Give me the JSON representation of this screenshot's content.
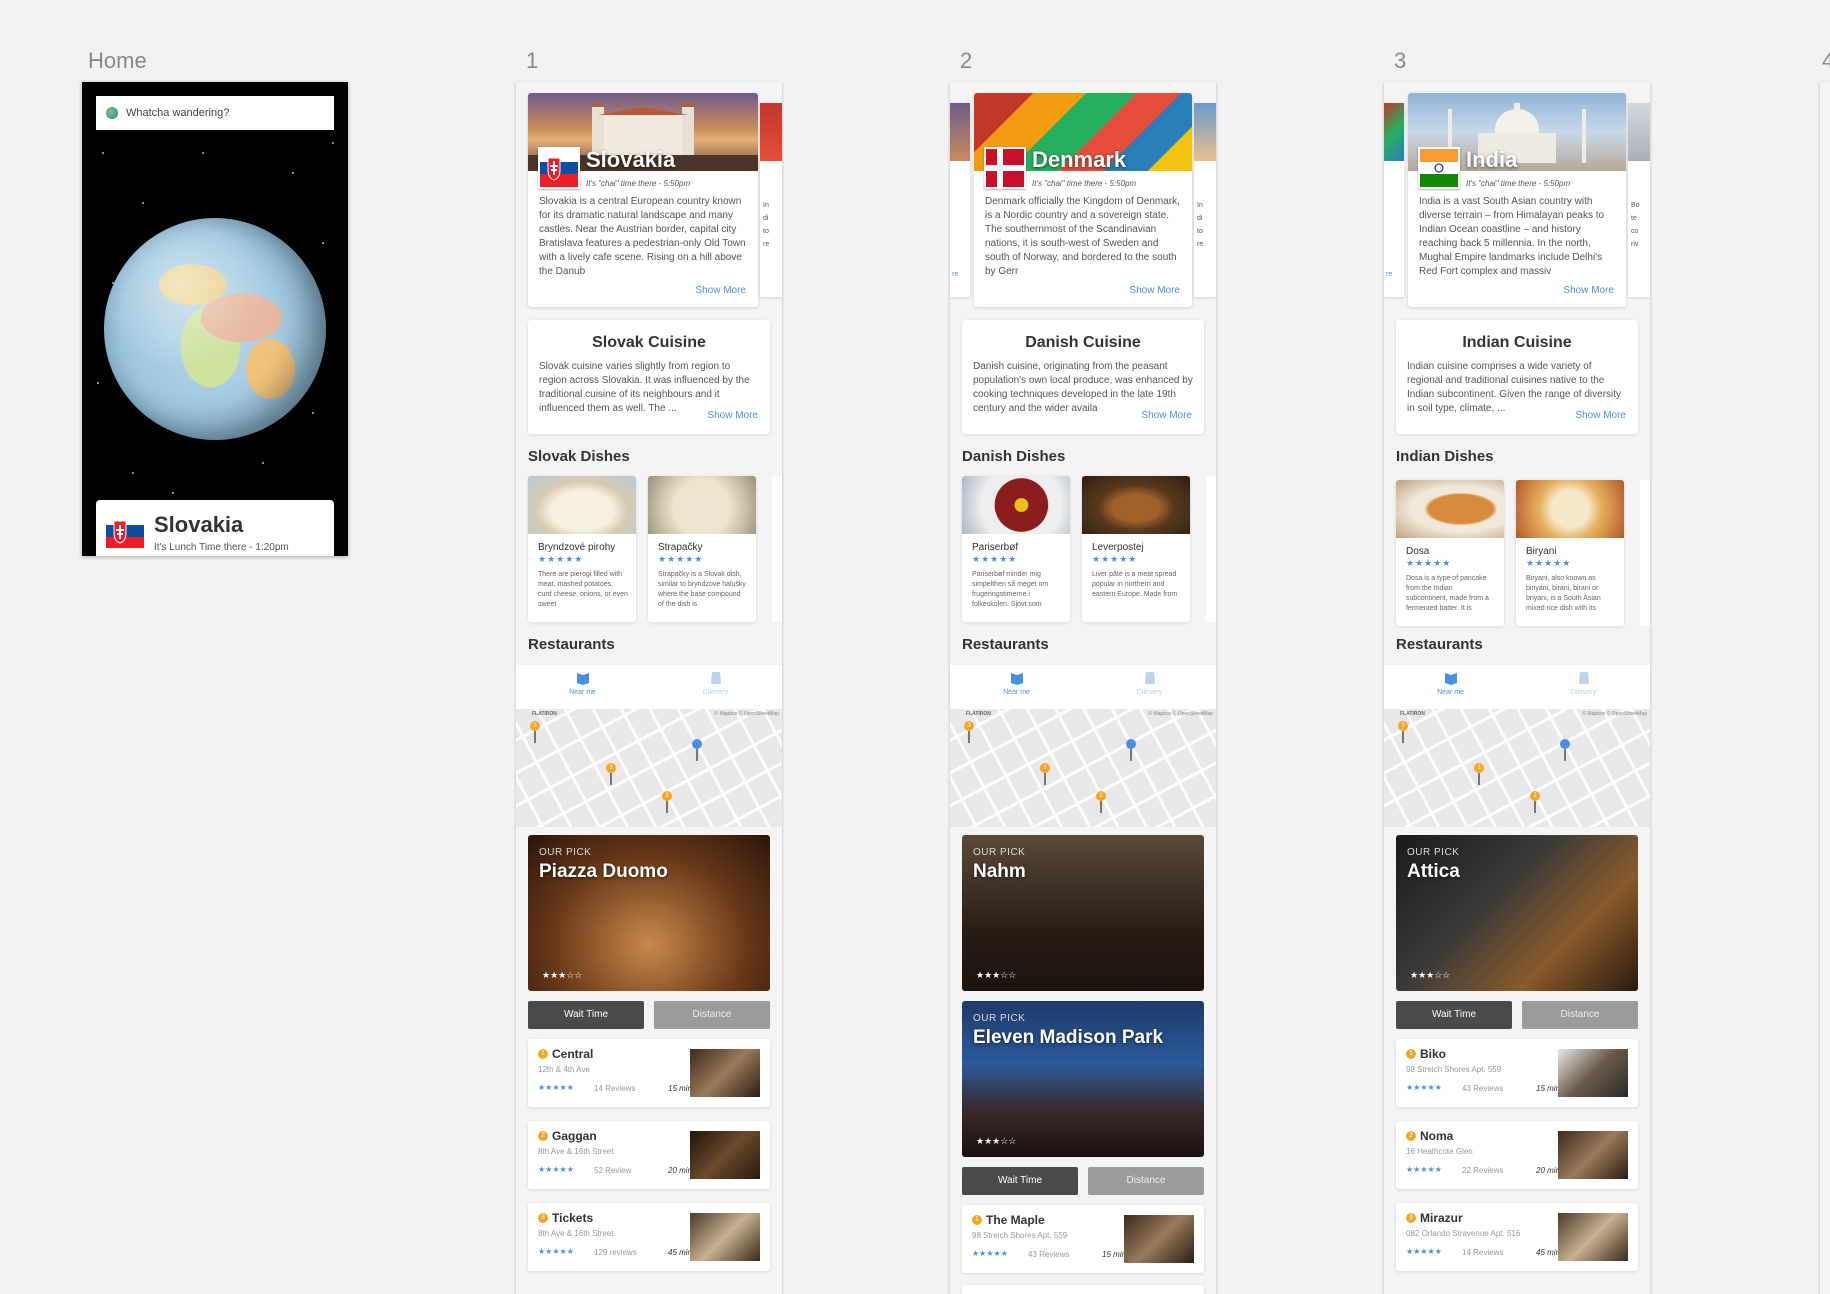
{
  "artboards": {
    "home": "Home",
    "s1": "1",
    "s2": "2",
    "s3": "3",
    "s4": "4"
  },
  "home": {
    "search_placeholder": "Whatcha wandering?",
    "card_country": "Slovakia",
    "card_time": "It's Lunch Time there - 1:20pm"
  },
  "screens": [
    {
      "country": "Slovakia",
      "time": "It's \"chai\" time there - 5:50pm",
      "description": "Slovakia is a central European country known for its dramatic natural landscape and many castles. Near the Austrian border, capital city Bratislava features a pedestrian-only Old Town with a lively cafe scene. Rising on a hill above the Danub",
      "show_more": "Show More",
      "cuisine_title": "Slovak Cuisine",
      "cuisine_body": "Slovak cuisine varies slightly from region to region across Slovakia. It was influenced by the traditional cuisine of its neighbours and it influenced them as well. The ...",
      "dishes_title": "Slovak Dishes",
      "dishes": [
        {
          "name": "Bryndzové pirohy",
          "stars": "★★★★★",
          "desc": "There are pierogi filled with meat, mashed potatoes, curd cheese, onions, or even sweet"
        },
        {
          "name": "Strapačky",
          "stars": "★★★★★",
          "desc": "Strapačky is a Slovak dish, similar to bryndzové halušky where the base compound of the dish is"
        }
      ],
      "restaurants_title": "Restaurants",
      "tab_near": "Near me",
      "tab_delivery": "Dilevery",
      "map_label": "FLATIRON",
      "map_credit": "© Mapbox © OpenStreetMap",
      "picks": [
        {
          "label": "OUR PICK",
          "name": "Piazza Duomo",
          "stars": "★★★☆☆"
        }
      ],
      "btn_wait": "Wait Time",
      "btn_distance": "Distance",
      "restaurants": [
        {
          "num": "1",
          "name": "Central",
          "addr": "12th & 4th Ave",
          "stars": "★★★★★",
          "reviews": "14 Reviews",
          "time": "15 min"
        },
        {
          "num": "2",
          "name": "Gaggan",
          "addr": "8th Ave & 16th Street",
          "stars": "★★★★★",
          "reviews": "52 Review",
          "time": "20 min"
        },
        {
          "num": "3",
          "name": "Tickets",
          "addr": "8th Ave & 16th Street",
          "stars": "★★★★★",
          "reviews": "129 reviews",
          "time": "45 min"
        }
      ],
      "peek_left": "",
      "peek_right": "In di to re"
    },
    {
      "country": "Denmark",
      "time": "It's \"chai\" time there - 5:50pm",
      "description": "Denmark officially the Kingdom of Denmark, is a Nordic country and a sovereign state. The southernmost of the Scandinavian nations, it is south-west of Sweden and south of Norway, and bordered to the south by Gerr",
      "show_more": "Show More",
      "cuisine_title": "Danish Cuisine",
      "cuisine_body": "Danish cuisine, originating from the peasant population's own local produce, was enhanced by cooking techniques developed in the late 19th century and the wider availa",
      "dishes_title": "Danish Dishes",
      "dishes": [
        {
          "name": "Pariserbøf",
          "stars": "★★★★★",
          "desc": "Pariserbøf minder mig simpelthen så meget om frugeringstimerne i folkeskolen. Sjovt som"
        },
        {
          "name": "Leverpostej",
          "stars": "★★★★★",
          "desc": "Liver pâté is a meat spread popular in northern and eastern Europe. Made from"
        }
      ],
      "restaurants_title": "Restaurants",
      "tab_near": "Near me",
      "tab_delivery": "Dilevery",
      "map_label": "FLATIRON",
      "map_credit": "© Mapbox © OpenStreetMap",
      "picks": [
        {
          "label": "OUR PICK",
          "name": "Nahm",
          "stars": "★★★☆☆"
        },
        {
          "label": "OUR PICK",
          "name": "Eleven Madison Park",
          "stars": "★★★☆☆"
        }
      ],
      "btn_wait": "Wait Time",
      "btn_distance": "Distance",
      "restaurants": [
        {
          "num": "1",
          "name": "The Maple",
          "addr": "98 Streich Shores Apt. 559",
          "stars": "★★★★★",
          "reviews": "43 Reviews",
          "time": "15 min"
        }
      ],
      "peek_left": "re",
      "peek_right": "In di to re"
    },
    {
      "country": "India",
      "time": "It's \"chai\" time there - 5:50pm",
      "description": "India is a vast South Asian country with diverse terrain – from Himalayan peaks to Indian Ocean coastline – and history reaching back 5 millennia. In the north, Mughal Empire landmarks include Delhi's Red Fort complex and massiv",
      "show_more": "Show More",
      "cuisine_title": "Indian Cuisine",
      "cuisine_body": "Indian cuisine comprises a wide variety of regional and traditional cuisines native to the Indian subcontinent. Given the range of diversity in soil type, climate, ...",
      "dishes_title": "Indian Dishes",
      "dishes": [
        {
          "name": "Dosa",
          "stars": "★★★★★",
          "desc": "Dosa is a type of pancake from the Indian subcontinent, made from a fermented batter. It is"
        },
        {
          "name": "Biryani",
          "stars": "★★★★★",
          "desc": "Biryani, also known as biriyani, birani, birani or briyani, is a South Asian mixed rice dish with its"
        }
      ],
      "restaurants_title": "Restaurants",
      "tab_near": "Near me",
      "tab_delivery": "Dilevery",
      "map_label": "FLATIRON",
      "map_credit": "© Mapbox © OpenStreetMap",
      "picks": [
        {
          "label": "OUR PICK",
          "name": "Attica",
          "stars": "★★★☆☆"
        }
      ],
      "btn_wait": "Wait Time",
      "btn_distance": "Distance",
      "restaurants": [
        {
          "num": "1",
          "name": "Biko",
          "addr": "98 Streich Shores Apt. 559",
          "stars": "★★★★★",
          "reviews": "43 Reviews",
          "time": "15 min"
        },
        {
          "num": "2",
          "name": "Noma",
          "addr": "16 Heathcote Glen",
          "stars": "★★★★★",
          "reviews": "22 Reviews",
          "time": "20 min"
        },
        {
          "num": "3",
          "name": "Mirazur",
          "addr": "082 Orlando Stravenue Apt. 516",
          "stars": "★★★★★",
          "reviews": "14 Reviews",
          "time": "45 min"
        }
      ],
      "peek_left": "re",
      "peek_right": "Bo te co riv"
    }
  ],
  "colors": {
    "accent": "#4a90e2",
    "pin_orange": "#f5a623",
    "pin_blue": "#4a90e2",
    "btn_dark": "#4a4a4a",
    "btn_grey": "#9b9b9b"
  }
}
